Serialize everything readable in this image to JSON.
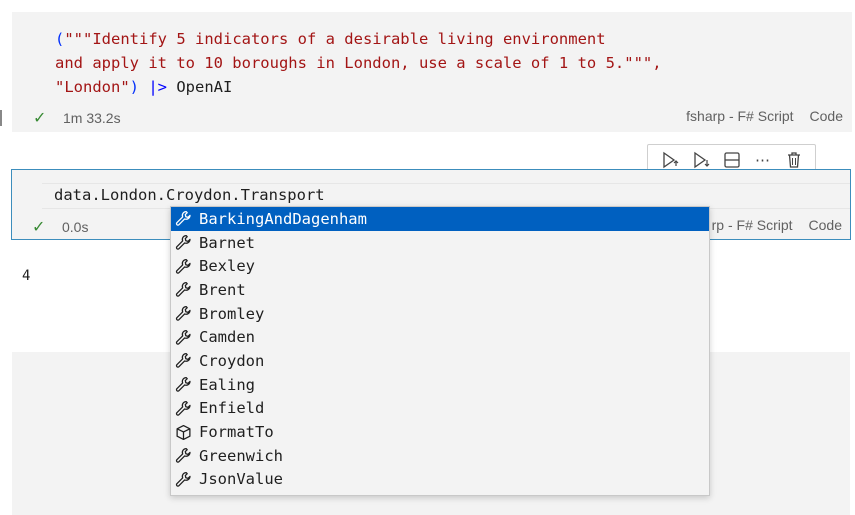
{
  "cell1": {
    "code_lines": [
      [
        "(",
        "\"\"\"Identify 5 indicators of a desirable living environment"
      ],
      [
        "",
        "and apply it to 10 boroughs in London, use a scale of 1 to 5.\"\"\","
      ],
      [
        "",
        "\"London\"",
        ") ",
        "|>",
        " OpenAI"
      ]
    ],
    "status_time": "1m 33.2s",
    "language": "fsharp - F# Script",
    "cell_type": "Code"
  },
  "cell2": {
    "code": "data.London.Croydon.Transport",
    "status_time": "0.0s",
    "language_partial": "rp - F# Script",
    "cell_type": "Code"
  },
  "output_value": "4",
  "toolbar": {
    "icons": [
      "execute-above-icon",
      "execute-below-icon",
      "split-cell-icon",
      "more-icon",
      "delete-icon"
    ]
  },
  "suggestions": [
    {
      "label": "BarkingAndDagenham",
      "kind": "wrench",
      "selected": true
    },
    {
      "label": "Barnet",
      "kind": "wrench"
    },
    {
      "label": "Bexley",
      "kind": "wrench"
    },
    {
      "label": "Brent",
      "kind": "wrench"
    },
    {
      "label": "Bromley",
      "kind": "wrench"
    },
    {
      "label": "Camden",
      "kind": "wrench"
    },
    {
      "label": "Croydon",
      "kind": "wrench"
    },
    {
      "label": "Ealing",
      "kind": "wrench"
    },
    {
      "label": "Enfield",
      "kind": "wrench"
    },
    {
      "label": "FormatTo",
      "kind": "cube"
    },
    {
      "label": "Greenwich",
      "kind": "wrench"
    },
    {
      "label": "JsonValue",
      "kind": "wrench"
    }
  ],
  "colors": {
    "accent": "#0060c0",
    "cell_border": "#3c8dbc",
    "string": "#a31515",
    "check": "#388a34"
  }
}
